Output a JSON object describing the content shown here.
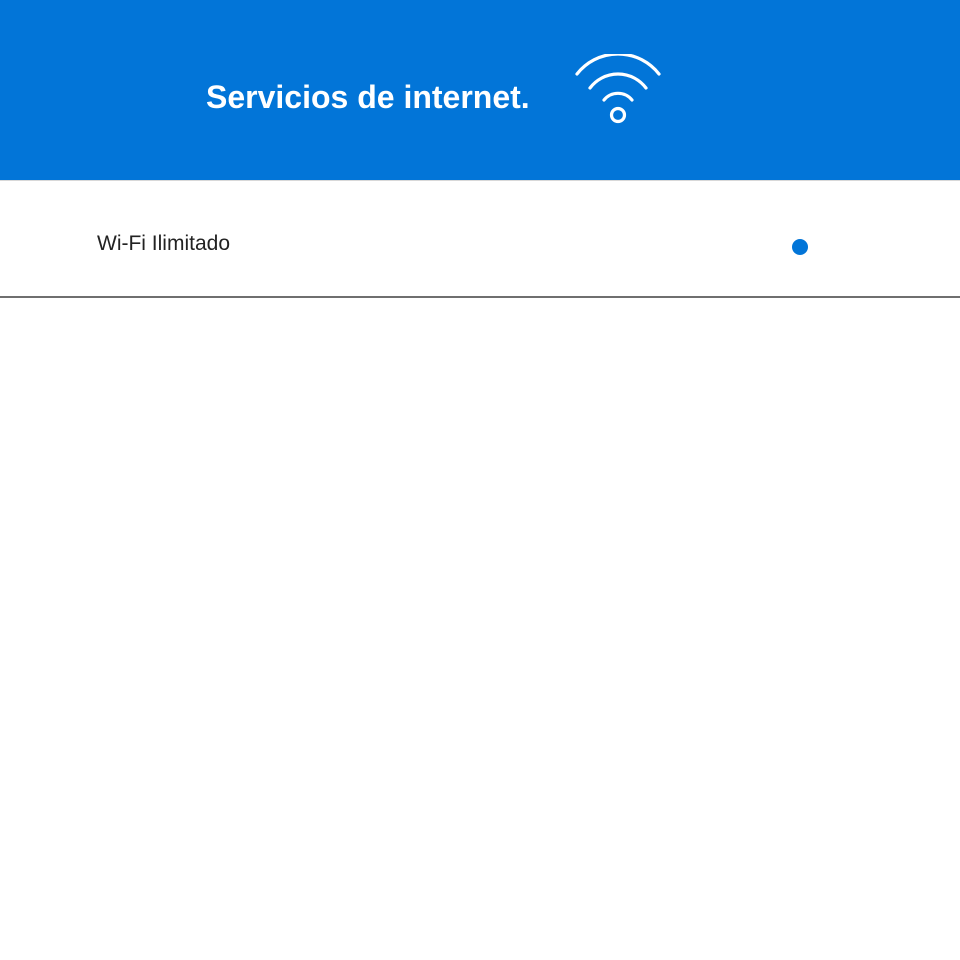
{
  "header": {
    "title": "Servicios de internet.",
    "icon": "wifi-icon",
    "background_color": "#0275d8",
    "text_color": "#ffffff"
  },
  "services": {
    "items": [
      {
        "label": "Wi-Fi Ilimitado",
        "indicator": "status-dot",
        "indicator_color": "#0275d8"
      }
    ]
  }
}
